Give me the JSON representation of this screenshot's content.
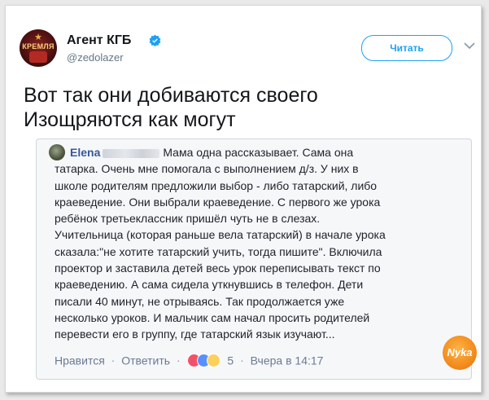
{
  "account": {
    "display_name": "Агент КГБ",
    "handle": "@zedolazer",
    "avatar_text": "КРЕМЛЯ",
    "follow_label": "Читать"
  },
  "tweet": {
    "lines": [
      "Вот так они добиваются своего",
      "Изощряются как могут"
    ]
  },
  "comment": {
    "author_first": "Elena",
    "first_text": "Мама одна рассказывает. Сама она",
    "lines": [
      "татарка. Очень мне помогала с выполнением д/з. У них в",
      "школе родителям предложили выбор - либо татарский, либо",
      "краеведение. Они выбрали краеведение. С первого же урока",
      "ребёнок третьеклассник пришёл чуть не в слезах.",
      "Учительница (которая раньше вела татарский) в начале урока",
      "сказала:\"не хотите татарский учить, тогда пишите\". Включила",
      "проектор и заставила детей весь урок переписывать текст по",
      "краеведению. А сама сидела уткнувшись в телефон. Дети",
      "писали 40 минут, не отрываясь. Так продолжается уже",
      "несколько уроков. И мальчик сам начал просить родителей",
      "перевести его в группу, где татарский язык изучают..."
    ],
    "like_label": "Нравится",
    "reply_label": "Ответить",
    "reaction_count": "5",
    "timestamp": "Вчера в 14:17"
  },
  "watermark": "Nyka",
  "colors": {
    "accent": "#1da1f2",
    "fb_link": "#365899"
  }
}
